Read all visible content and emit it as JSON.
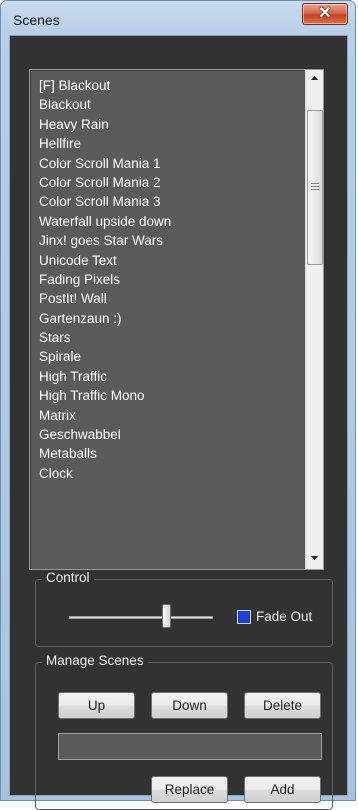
{
  "window": {
    "title": "Scenes",
    "close_glyph": "✕"
  },
  "scene_list": {
    "items": [
      "[F] Blackout",
      "Blackout",
      "Heavy Rain",
      "Hellfire",
      "Color Scroll Mania 1",
      "Color Scroll Mania 2",
      "Color Scroll Mania 3",
      "Waterfall upside down",
      "Jinx! goes Star Wars",
      "Unicode Text",
      "Fading Pixels",
      "PostIt! Wall",
      "Gartenzaun :)",
      "Stars",
      "Spirale",
      "High Traffic",
      "High Traffic Mono",
      "Matrix",
      "Geschwabbel",
      "Metaballs",
      "Clock"
    ]
  },
  "control": {
    "label": "Control",
    "slider_level": 0.68,
    "fade_out_label": "Fade Out",
    "fade_out_checked": true
  },
  "manage": {
    "label": "Manage Scenes",
    "up_label": "Up",
    "down_label": "Down",
    "delete_label": "Delete",
    "name_value": "",
    "replace_label": "Replace",
    "add_label": "Add"
  },
  "colors": {
    "client_bg": "#323232",
    "list_bg": "#5a5a5a",
    "checkbox_fill": "#1d3fd6"
  }
}
